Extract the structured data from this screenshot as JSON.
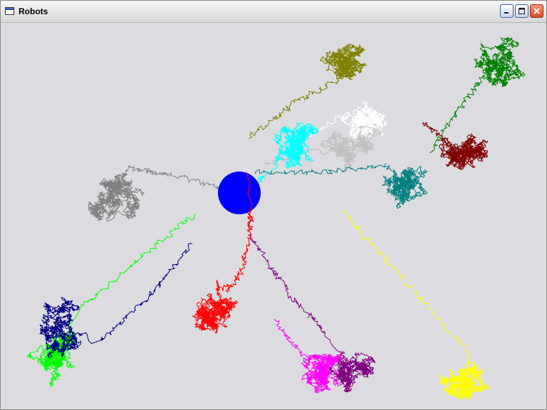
{
  "window": {
    "title": "Robots",
    "icon": "window-icon",
    "buttons": [
      {
        "name": "minimize-button",
        "icon": "minimize-icon"
      },
      {
        "name": "maximize-button",
        "icon": "maximize-icon"
      },
      {
        "name": "close-button",
        "icon": "close-icon"
      }
    ]
  },
  "scene": {
    "background": "#dcdce0",
    "ball_color": "#0000ff",
    "robot_colors": {
      "olive": "#808000",
      "green": "#008000",
      "white": "#ffffff",
      "silver": "#c0c0c0",
      "cyan": "#00ffff",
      "teal": "#008080",
      "maroon": "#800000",
      "gray": "#808080",
      "lime": "#00ff00",
      "navy": "#000080",
      "red": "#ff0000",
      "purple": "#800080",
      "magenta": "#ff00ff",
      "yellow": "#ffff00"
    }
  }
}
